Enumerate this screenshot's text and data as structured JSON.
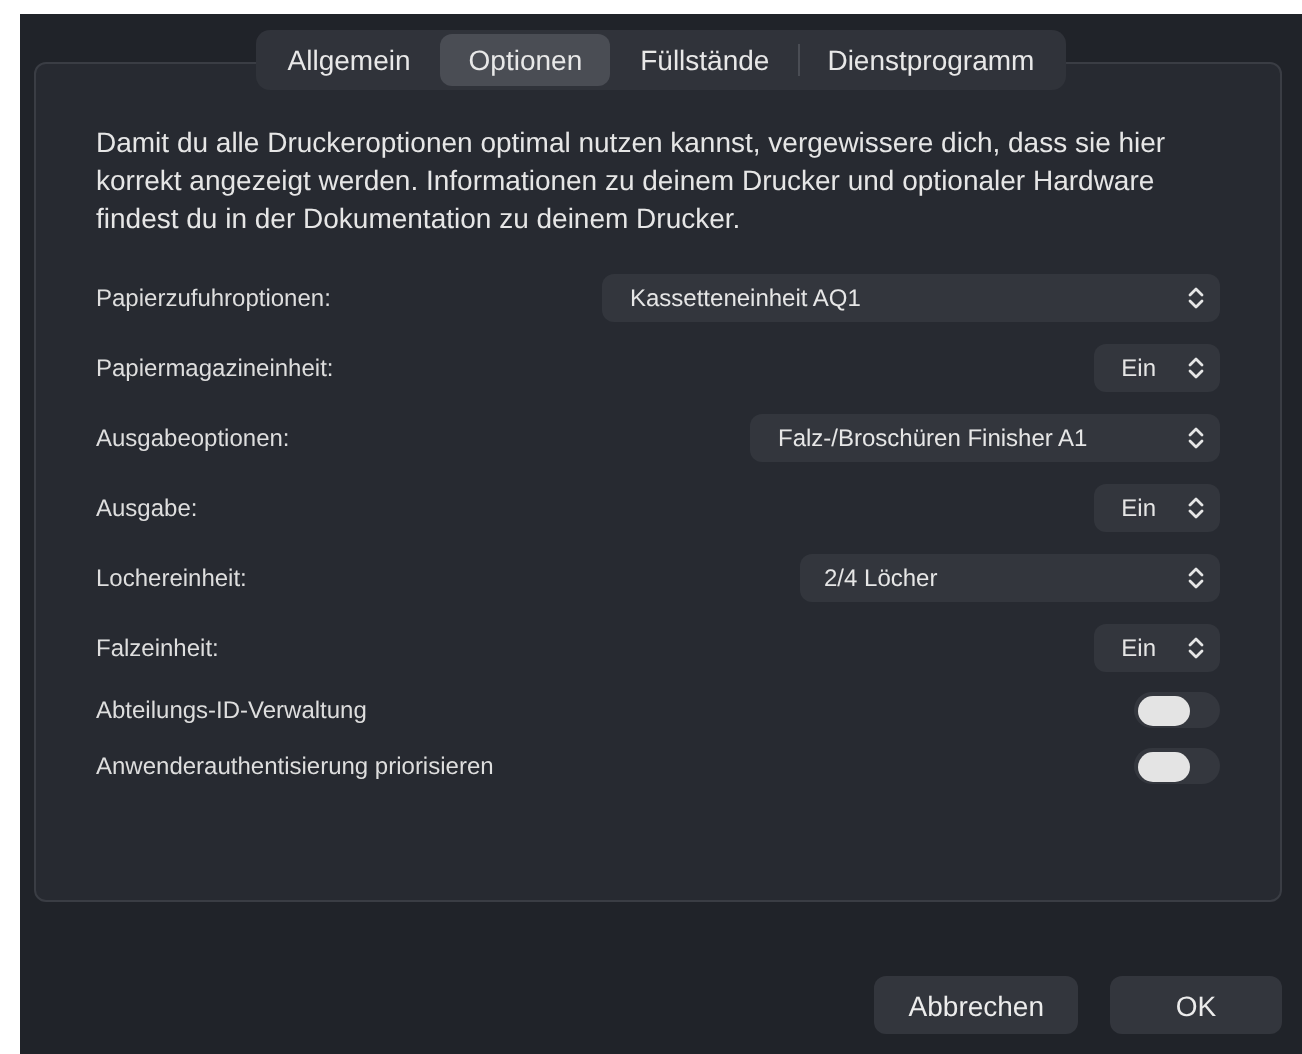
{
  "tabs": [
    {
      "label": "Allgemein",
      "selected": false
    },
    {
      "label": "Optionen",
      "selected": true
    },
    {
      "label": "Füllstände",
      "selected": false
    },
    {
      "label": "Dienstprogramm",
      "selected": false
    }
  ],
  "description": "Damit du alle Druckeroptionen optimal nutzen kannst, vergewissere dich, dass sie hier korrekt angezeigt werden. Informationen zu deinem Drucker und optionaler Hardware findest du in der Dokumentation zu deinem Drucker.",
  "options": [
    {
      "kind": "popup",
      "label": "Papierzufuhroptionen:",
      "value": "Kassetteneinheit AQ1"
    },
    {
      "kind": "popup",
      "label": "Papiermagazineinheit:",
      "value": "Ein"
    },
    {
      "kind": "popup",
      "label": "Ausgabeoptionen:",
      "value": "Falz-/Broschüren Finisher A1"
    },
    {
      "kind": "popup",
      "label": "Ausgabe:",
      "value": "Ein"
    },
    {
      "kind": "popup",
      "label": "Lochereinheit:",
      "value": "2/4 Löcher"
    },
    {
      "kind": "popup",
      "label": "Falzeinheit:",
      "value": "Ein"
    },
    {
      "kind": "toggle",
      "label": "Abteilungs-ID-Verwaltung",
      "on": false
    },
    {
      "kind": "toggle",
      "label": "Anwenderauthentisierung priorisieren",
      "on": false
    }
  ],
  "buttons": [
    {
      "label": "Abbrechen"
    },
    {
      "label": "OK"
    }
  ]
}
